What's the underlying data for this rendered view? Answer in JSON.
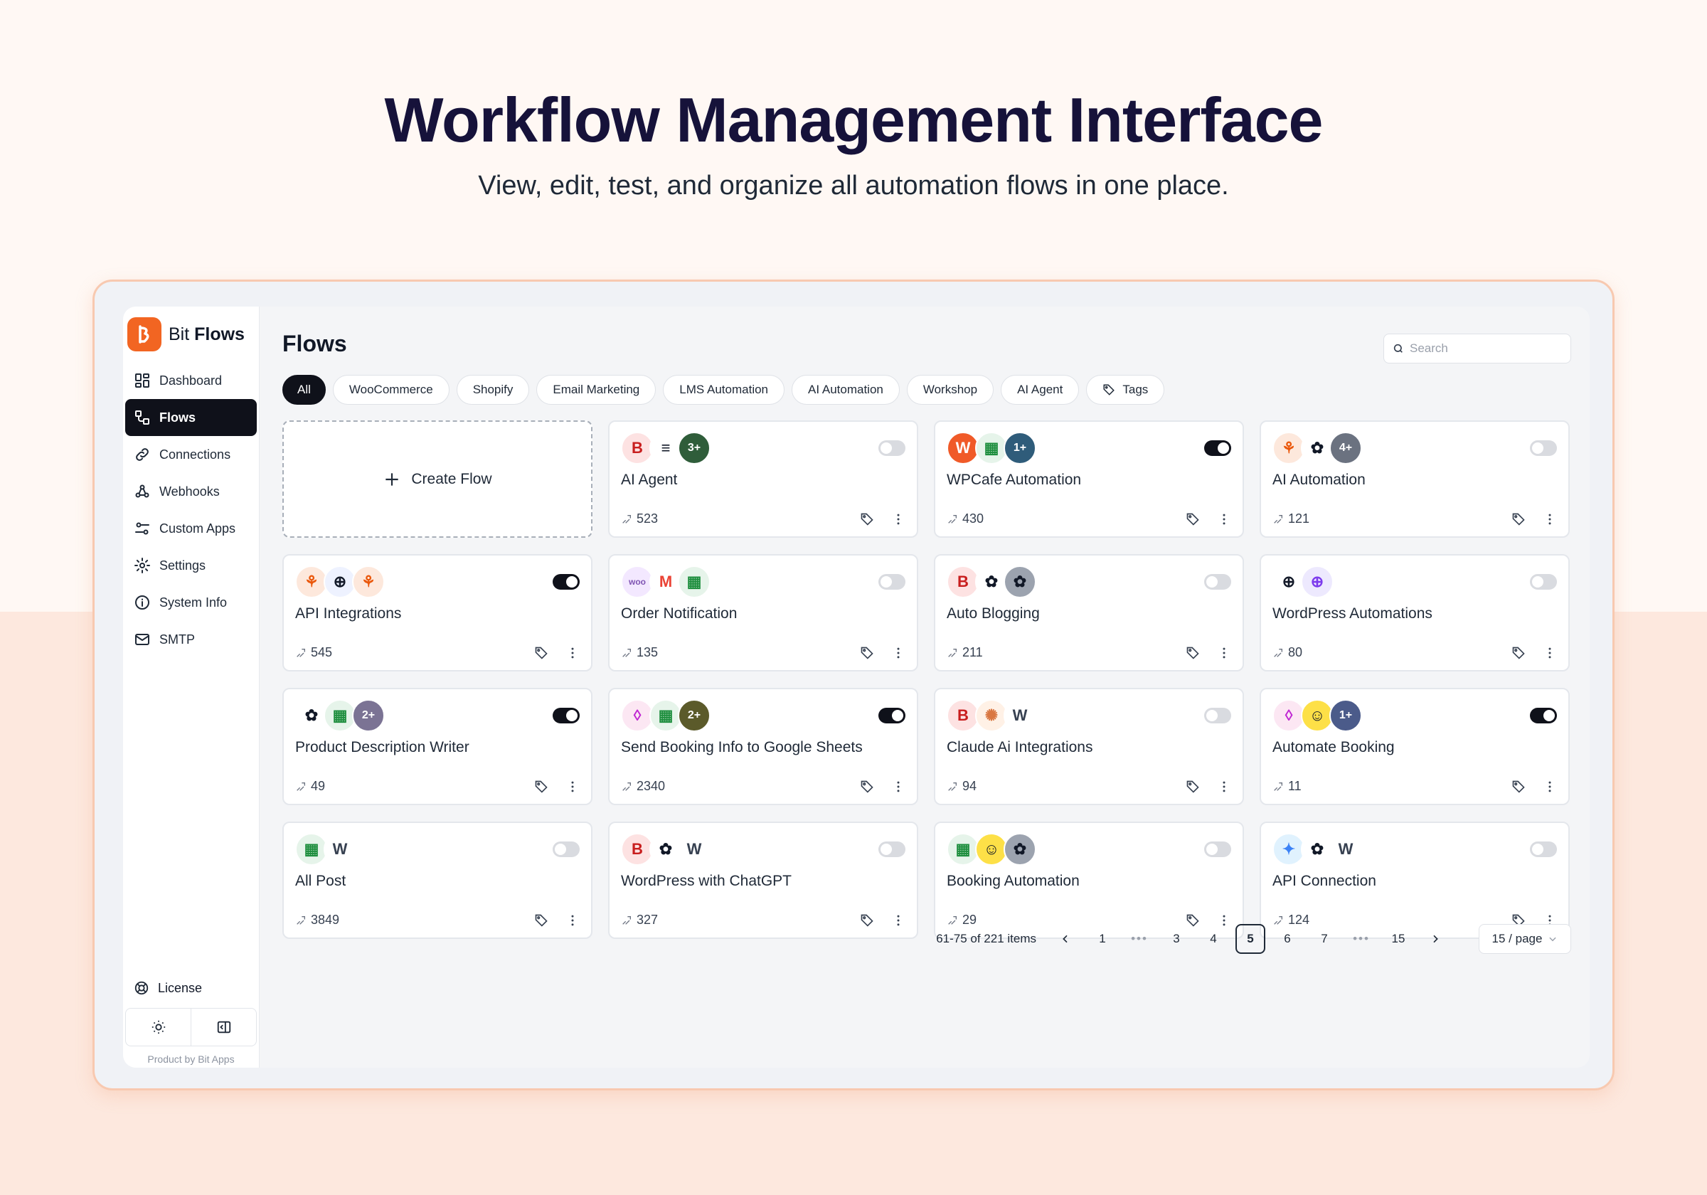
{
  "hero": {
    "title": "Workflow Management Interface",
    "subtitle": "View, edit, test, and organize all automation flows in one place."
  },
  "brand": {
    "name_regular": "Bit ",
    "name_bold": "Flows",
    "accent": "#f26522"
  },
  "sidebar": {
    "items": [
      {
        "label": "Dashboard",
        "icon": "dashboard-icon",
        "active": false
      },
      {
        "label": "Flows",
        "icon": "flows-icon",
        "active": true
      },
      {
        "label": "Connections",
        "icon": "link-icon",
        "active": false
      },
      {
        "label": "Webhooks",
        "icon": "webhook-icon",
        "active": false
      },
      {
        "label": "Custom Apps",
        "icon": "custom-apps-icon",
        "active": false
      },
      {
        "label": "Settings",
        "icon": "gear-icon",
        "active": false
      },
      {
        "label": "System Info",
        "icon": "info-icon",
        "active": false
      },
      {
        "label": "SMTP",
        "icon": "mail-icon",
        "active": false
      }
    ],
    "license_label": "License",
    "product_by": "Product by Bit Apps"
  },
  "main": {
    "title": "Flows",
    "search_placeholder": "Search",
    "tabs": [
      "All",
      "WooCommerce",
      "Shopify",
      "Email Marketing",
      "LMS Automation",
      "AI Automation",
      "Workshop",
      "AI Agent",
      "Tags"
    ],
    "create_label": "Create Flow"
  },
  "flows": [
    {
      "name": "AI Agent",
      "count": "523",
      "enabled": false,
      "apps": [
        {
          "icon": "bit-icon",
          "bg": "#fde2e2",
          "fg": "#c81e1e",
          "text": "B"
        },
        {
          "icon": "database-icon",
          "bg": "#ffffff",
          "fg": "#111827",
          "text": "≡"
        },
        {
          "icon": "more-apps-icon",
          "bg": "#2f5d3a",
          "fg": "#ffffff",
          "text": "3+"
        }
      ]
    },
    {
      "name": "WPCafe Automation",
      "count": "430",
      "enabled": true,
      "apps": [
        {
          "icon": "wpcafe-icon",
          "bg": "#f05a28",
          "fg": "#ffffff",
          "text": "W"
        },
        {
          "icon": "google-sheets-icon",
          "bg": "#e6f4ea",
          "fg": "#1e8e3e",
          "text": "▦"
        },
        {
          "icon": "more-apps-icon",
          "bg": "#2f5c7a",
          "fg": "#ffffff",
          "text": "1+"
        }
      ]
    },
    {
      "name": "AI Automation",
      "count": "121",
      "enabled": false,
      "apps": [
        {
          "icon": "webhook-icon",
          "bg": "#fde8dc",
          "fg": "#ea580c",
          "text": "⚘"
        },
        {
          "icon": "openai-icon",
          "bg": "#ffffff",
          "fg": "#111827",
          "text": "✿"
        },
        {
          "icon": "more-apps-icon",
          "bg": "#6b7280",
          "fg": "#ffffff",
          "text": "4+"
        }
      ]
    },
    {
      "name": "API Integrations",
      "count": "545",
      "enabled": true,
      "apps": [
        {
          "icon": "webhook-icon",
          "bg": "#fde8dc",
          "fg": "#ea580c",
          "text": "⚘"
        },
        {
          "icon": "globe-icon",
          "bg": "#eef2ff",
          "fg": "#111827",
          "text": "⊕"
        },
        {
          "icon": "webhook-icon",
          "bg": "#fde8dc",
          "fg": "#ea580c",
          "text": "⚘"
        }
      ]
    },
    {
      "name": "Order Notification",
      "count": "135",
      "enabled": false,
      "apps": [
        {
          "icon": "woocommerce-icon",
          "bg": "#f3e8ff",
          "fg": "#7f54b3",
          "text": "woo"
        },
        {
          "icon": "gmail-icon",
          "bg": "#ffffff",
          "fg": "#ea4335",
          "text": "M"
        },
        {
          "icon": "google-sheets-icon",
          "bg": "#e6f4ea",
          "fg": "#1e8e3e",
          "text": "▦"
        }
      ]
    },
    {
      "name": "Auto Blogging",
      "count": "211",
      "enabled": false,
      "apps": [
        {
          "icon": "bit-icon",
          "bg": "#fde2e2",
          "fg": "#c81e1e",
          "text": "B"
        },
        {
          "icon": "openai-icon",
          "bg": "#ffffff",
          "fg": "#111827",
          "text": "✿"
        },
        {
          "icon": "openai-icon",
          "bg": "#9ca3af",
          "fg": "#111827",
          "text": "✿"
        }
      ]
    },
    {
      "name": "WordPress Automations",
      "count": "80",
      "enabled": false,
      "apps": [
        {
          "icon": "globe-icon",
          "bg": "#ffffff",
          "fg": "#111827",
          "text": "⊕"
        },
        {
          "icon": "globe-purple-icon",
          "bg": "#ede9fe",
          "fg": "#7c3aed",
          "text": "⊕"
        }
      ]
    },
    {
      "name": "Product Description Writer",
      "count": "49",
      "enabled": true,
      "apps": [
        {
          "icon": "openai-icon",
          "bg": "#ffffff",
          "fg": "#111827",
          "text": "✿"
        },
        {
          "icon": "google-sheets-icon",
          "bg": "#e6f4ea",
          "fg": "#1e8e3e",
          "text": "▦"
        },
        {
          "icon": "more-apps-icon",
          "bg": "#7b7394",
          "fg": "#ffffff",
          "text": "2+"
        }
      ]
    },
    {
      "name": "Send Booking Info to Google Sheets",
      "count": "2340",
      "enabled": true,
      "apps": [
        {
          "icon": "booking-icon",
          "bg": "#fce7f3",
          "fg": "#c026d3",
          "text": "◊"
        },
        {
          "icon": "google-sheets-icon",
          "bg": "#e6f4ea",
          "fg": "#1e8e3e",
          "text": "▦"
        },
        {
          "icon": "more-apps-icon",
          "bg": "#5b5a2a",
          "fg": "#ffffff",
          "text": "2+"
        }
      ]
    },
    {
      "name": "Claude Ai Integrations",
      "count": "94",
      "enabled": false,
      "apps": [
        {
          "icon": "bit-icon",
          "bg": "#fde2e2",
          "fg": "#c81e1e",
          "text": "B"
        },
        {
          "icon": "claude-icon",
          "bg": "#fff1e6",
          "fg": "#d97742",
          "text": "✺"
        },
        {
          "icon": "wordpress-icon",
          "bg": "#ffffff",
          "fg": "#374151",
          "text": "W"
        }
      ]
    },
    {
      "name": "Automate Booking",
      "count": "11",
      "enabled": true,
      "apps": [
        {
          "icon": "booking-icon",
          "bg": "#fce7f3",
          "fg": "#c026d3",
          "text": "◊"
        },
        {
          "icon": "mailchimp-icon",
          "bg": "#fde047",
          "fg": "#111827",
          "text": "☺"
        },
        {
          "icon": "more-apps-icon",
          "bg": "#4b5b8a",
          "fg": "#ffffff",
          "text": "1+"
        }
      ]
    },
    {
      "name": "All Post",
      "count": "3849",
      "enabled": false,
      "apps": [
        {
          "icon": "google-sheets-icon",
          "bg": "#e6f4ea",
          "fg": "#1e8e3e",
          "text": "▦"
        },
        {
          "icon": "wordpress-icon",
          "bg": "#ffffff",
          "fg": "#374151",
          "text": "W"
        }
      ]
    },
    {
      "name": "WordPress with ChatGPT",
      "count": "327",
      "enabled": false,
      "apps": [
        {
          "icon": "bit-icon",
          "bg": "#fde2e2",
          "fg": "#c81e1e",
          "text": "B"
        },
        {
          "icon": "openai-icon",
          "bg": "#ffffff",
          "fg": "#111827",
          "text": "✿"
        },
        {
          "icon": "wordpress-icon",
          "bg": "#ffffff",
          "fg": "#374151",
          "text": "W"
        }
      ]
    },
    {
      "name": "Booking Automation",
      "count": "29",
      "enabled": false,
      "apps": [
        {
          "icon": "google-sheets-icon",
          "bg": "#e6f4ea",
          "fg": "#1e8e3e",
          "text": "▦"
        },
        {
          "icon": "mailchimp-icon",
          "bg": "#fde047",
          "fg": "#111827",
          "text": "☺"
        },
        {
          "icon": "openai-icon",
          "bg": "#9ca3af",
          "fg": "#111827",
          "text": "✿"
        }
      ]
    },
    {
      "name": "API Connection",
      "count": "124",
      "enabled": false,
      "apps": [
        {
          "icon": "gemini-icon",
          "bg": "#e0f2fe",
          "fg": "#3b82f6",
          "text": "✦"
        },
        {
          "icon": "openai-icon",
          "bg": "#ffffff",
          "fg": "#111827",
          "text": "✿"
        },
        {
          "icon": "wordpress-icon",
          "bg": "#ffffff",
          "fg": "#374151",
          "text": "W"
        }
      ]
    }
  ],
  "pagination": {
    "summary": "61-75 of 221 items",
    "pages": [
      "1",
      "•••",
      "3",
      "4",
      "5",
      "6",
      "7",
      "•••",
      "15"
    ],
    "current": "5",
    "per_page": "15 / page"
  }
}
